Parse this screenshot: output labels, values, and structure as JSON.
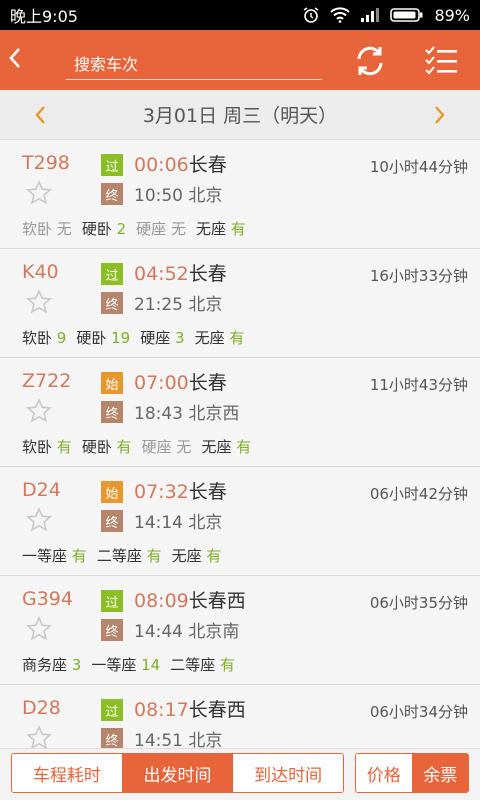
{
  "status": {
    "time": "晚上9:05",
    "battery": "89%"
  },
  "appbar": {
    "back_icon": "chevron-left-icon",
    "search_placeholder": "搜索车次"
  },
  "datebar": {
    "prev": "‹",
    "date": "3月01日 周三（明天）",
    "next": "›"
  },
  "trains": [
    {
      "no": "T298",
      "dep_tag": "过",
      "dep_tag_type": "pass",
      "dep_time": "00:06",
      "dep_station": "长春",
      "arr_tag": "终",
      "arr_time": "10:50",
      "arr_station": "北京",
      "duration": "10小时44分钟",
      "seats": [
        {
          "label": "软卧",
          "count": "无",
          "avail": false
        },
        {
          "label": "硬卧",
          "count": "2",
          "avail": true
        },
        {
          "label": "硬座",
          "count": "无",
          "avail": false
        },
        {
          "label": "无座",
          "count": "有",
          "avail": true
        }
      ]
    },
    {
      "no": "K40",
      "dep_tag": "过",
      "dep_tag_type": "pass",
      "dep_time": "04:52",
      "dep_station": "长春",
      "arr_tag": "终",
      "arr_time": "21:25",
      "arr_station": "北京",
      "duration": "16小时33分钟",
      "seats": [
        {
          "label": "软卧",
          "count": "9",
          "avail": true
        },
        {
          "label": "硬卧",
          "count": "19",
          "avail": true
        },
        {
          "label": "硬座",
          "count": "3",
          "avail": true
        },
        {
          "label": "无座",
          "count": "有",
          "avail": true
        }
      ]
    },
    {
      "no": "Z722",
      "dep_tag": "始",
      "dep_tag_type": "start",
      "dep_time": "07:00",
      "dep_station": "长春",
      "arr_tag": "终",
      "arr_time": "18:43",
      "arr_station": "北京西",
      "duration": "11小时43分钟",
      "seats": [
        {
          "label": "软卧",
          "count": "有",
          "avail": true
        },
        {
          "label": "硬卧",
          "count": "有",
          "avail": true
        },
        {
          "label": "硬座",
          "count": "无",
          "avail": false
        },
        {
          "label": "无座",
          "count": "有",
          "avail": true
        }
      ]
    },
    {
      "no": "D24",
      "dep_tag": "始",
      "dep_tag_type": "start",
      "dep_time": "07:32",
      "dep_station": "长春",
      "arr_tag": "终",
      "arr_time": "14:14",
      "arr_station": "北京",
      "duration": "06小时42分钟",
      "seats": [
        {
          "label": "一等座",
          "count": "有",
          "avail": true
        },
        {
          "label": "二等座",
          "count": "有",
          "avail": true
        },
        {
          "label": "无座",
          "count": "有",
          "avail": true
        }
      ]
    },
    {
      "no": "G394",
      "dep_tag": "过",
      "dep_tag_type": "pass",
      "dep_time": "08:09",
      "dep_station": "长春西",
      "arr_tag": "终",
      "arr_time": "14:44",
      "arr_station": "北京南",
      "duration": "06小时35分钟",
      "seats": [
        {
          "label": "商务座",
          "count": "3",
          "avail": true
        },
        {
          "label": "一等座",
          "count": "14",
          "avail": true
        },
        {
          "label": "二等座",
          "count": "有",
          "avail": true
        }
      ]
    },
    {
      "no": "D28",
      "dep_tag": "过",
      "dep_tag_type": "pass",
      "dep_time": "08:17",
      "dep_station": "长春西",
      "arr_tag": "终",
      "arr_time": "14:51",
      "arr_station": "北京",
      "duration": "06小时34分钟",
      "seats": []
    }
  ],
  "bottom": {
    "sort": [
      "车程耗时",
      "出发时间",
      "到达时间"
    ],
    "sort_active": 1,
    "filter": [
      "价格",
      "余票"
    ],
    "filter_active": 1
  },
  "colors": {
    "accent": "#e8643a",
    "available": "#7fb02a",
    "pass_tag": "#8cbf26",
    "start_tag": "#e8962e",
    "end_tag": "#b5856c"
  }
}
